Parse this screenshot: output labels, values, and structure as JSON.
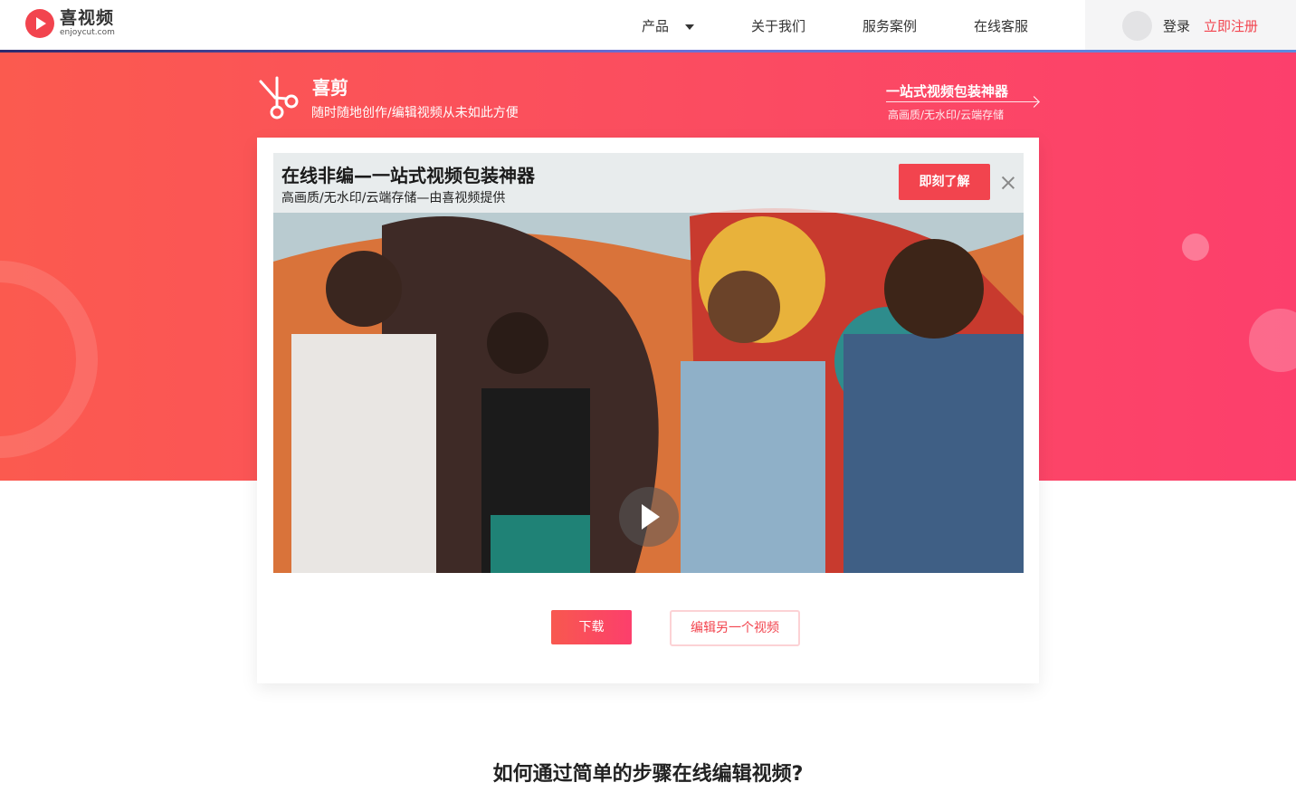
{
  "header": {
    "logo_title": "喜视频",
    "logo_sub": "enjoycut.com",
    "nav": [
      {
        "label": "产品"
      },
      {
        "label": "关于我们"
      },
      {
        "label": "服务案例"
      },
      {
        "label": "在线客服"
      }
    ],
    "login": "登录",
    "register": "立即注册"
  },
  "hero": {
    "brand_title": "喜剪",
    "brand_sub": "随时随地创作/编辑视频从未如此方便",
    "promo_title": "一站式视频包装神器",
    "promo_sub": "高画质/无水印/云端存储"
  },
  "player": {
    "ad_title": "在线非编—一站式视频包装神器",
    "ad_sub": "高画质/无水印/云端存储—由喜视频提供",
    "ad_button": "即刻了解"
  },
  "actions": {
    "download": "下载",
    "edit_another": "编辑另一个视频"
  },
  "section": {
    "title": "如何通过简单的步骤在线编辑视频?"
  },
  "colors": {
    "accent": "#f2444e",
    "hero_start": "#fb5a4f",
    "hero_end": "#fc3f6c"
  }
}
